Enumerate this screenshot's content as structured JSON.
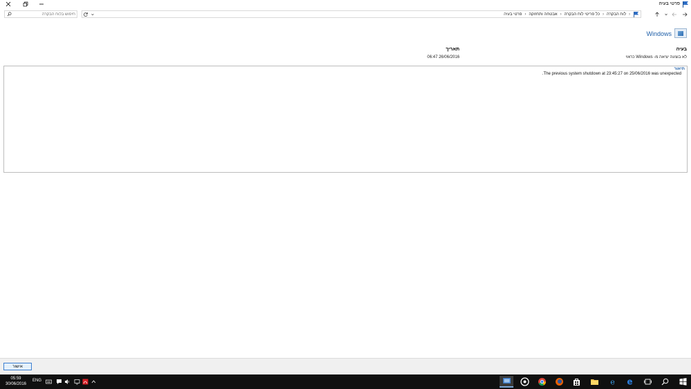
{
  "window": {
    "title": "פרטי בעיה",
    "controls": {
      "minimize": "minimize",
      "restore": "restore",
      "close": "close"
    }
  },
  "nav": {
    "breadcrumbs": [
      "לוח הבקרה",
      "כל פריטי לוח הבקרה",
      "אבטחה ותחזוקה",
      "פרטי בעיה"
    ],
    "search_placeholder": "חיפוש בלוח הבקרה"
  },
  "header": {
    "logo_label": "Windows"
  },
  "problem": {
    "problem_heading": "בעיה",
    "problem_value": "לא בוצעה יציאה מ- Windows כראוי",
    "date_heading": "תאריך",
    "date_value": "26/06/2016 06:47"
  },
  "description": {
    "heading": "תיאור",
    "text": "The previous system shutdown at 23:45:27 on 25/06/2016 was unexpected."
  },
  "footer": {
    "ok_label": "אישור"
  },
  "taskbar": {
    "time": "05:59",
    "date": "30/06/2016",
    "language": "ENG",
    "apps": [
      "action-center-icon",
      "media-player-icon",
      "chrome-icon",
      "firefox-icon",
      "store-icon",
      "file-explorer-icon",
      "internet-explorer-icon",
      "edge-icon",
      "task-view-icon",
      "search-icon",
      "start-icon"
    ]
  },
  "colors": {
    "accent": "#1f5fa8",
    "taskbar": "#101010",
    "ok_border": "#3c7fd1"
  }
}
